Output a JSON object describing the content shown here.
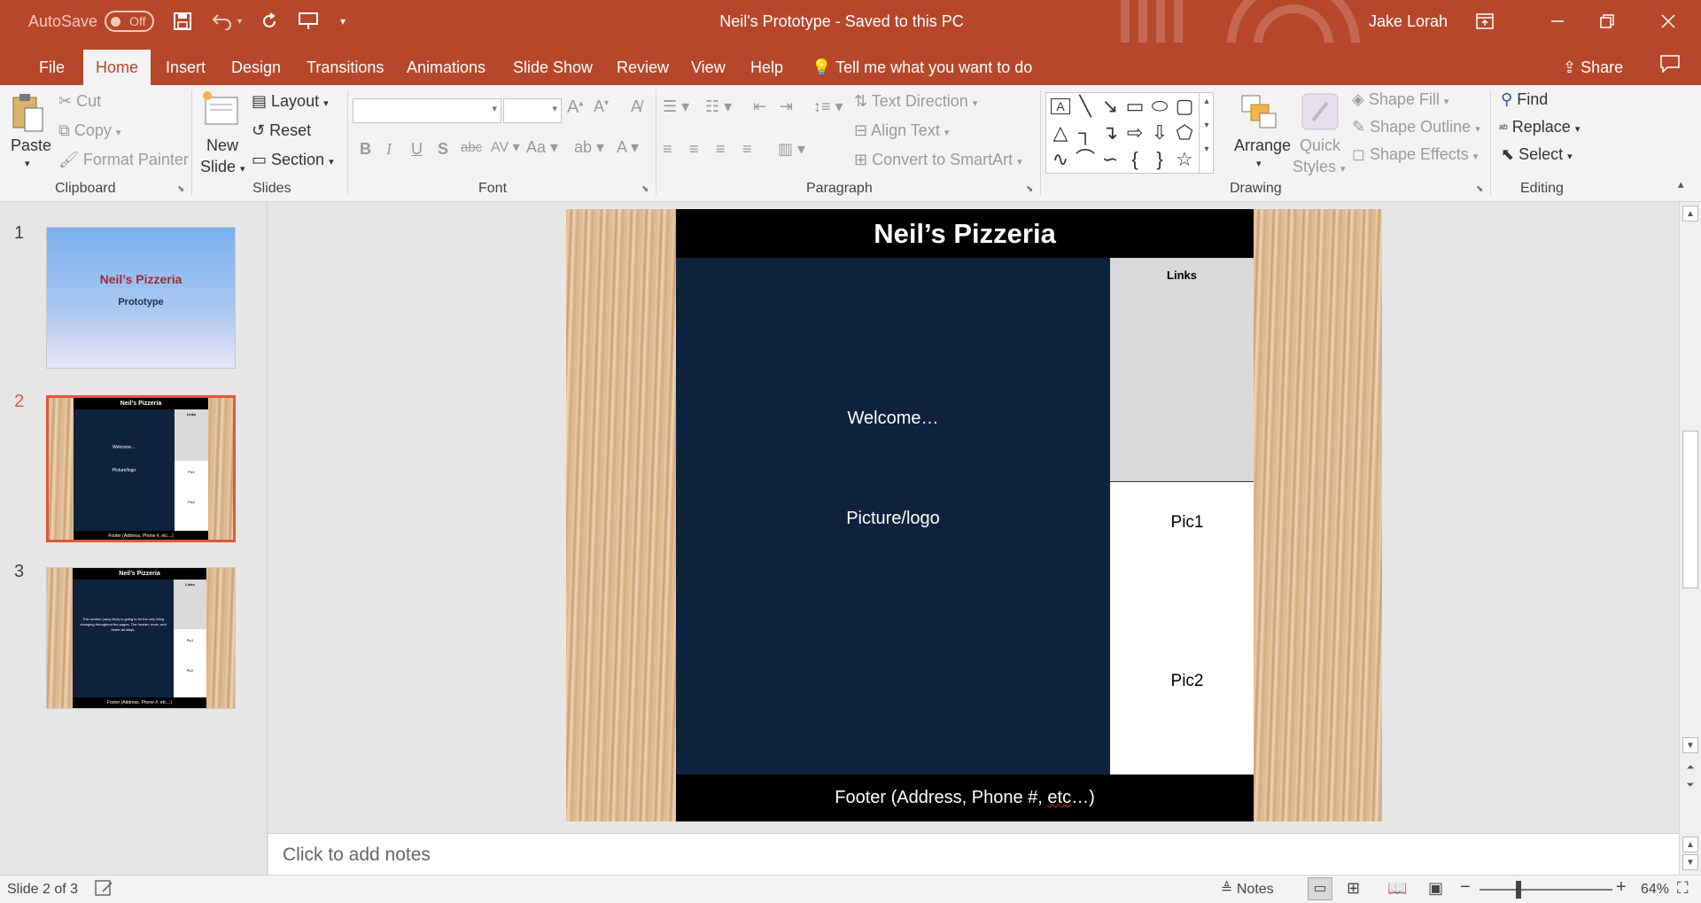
{
  "titlebar": {
    "autosave_label": "AutoSave",
    "autosave_state": "Off",
    "doc_title": "Neil's Prototype  -  Saved to this PC",
    "user": "Jake Lorah"
  },
  "tabs": [
    "File",
    "Home",
    "Insert",
    "Design",
    "Transitions",
    "Animations",
    "Slide Show",
    "Review",
    "View",
    "Help"
  ],
  "tell_me": "Tell me what you want to do",
  "share": "Share",
  "ribbon": {
    "clipboard": {
      "paste": "Paste",
      "cut": "Cut",
      "copy": "Copy",
      "format_painter": "Format Painter",
      "label": "Clipboard"
    },
    "slides": {
      "new_slide_1": "New",
      "new_slide_2": "Slide",
      "layout": "Layout",
      "reset": "Reset",
      "section": "Section",
      "label": "Slides"
    },
    "font": {
      "label": "Font"
    },
    "paragraph": {
      "text_direction": "Text Direction",
      "align_text": "Align Text",
      "convert_smartart": "Convert to SmartArt",
      "label": "Paragraph"
    },
    "drawing": {
      "arrange": "Arrange",
      "quick_1": "Quick",
      "quick_2": "Styles",
      "shape_fill": "Shape Fill",
      "shape_outline": "Shape Outline",
      "shape_effects": "Shape Effects",
      "label": "Drawing"
    },
    "editing": {
      "find": "Find",
      "replace": "Replace",
      "select": "Select",
      "label": "Editing"
    }
  },
  "thumbnails": [
    {
      "num": "1",
      "title": "Neil’s Pizzeria",
      "subtitle": "Prototype"
    },
    {
      "num": "2",
      "title": "Neil’s Pizzeria",
      "links": "Links",
      "welcome": "Welcome…",
      "picture": "Picture/logo",
      "pic1": "Pic1",
      "pic2": "Pic2",
      "footer": "Footer (Address, Phone #, etc…)"
    },
    {
      "num": "3",
      "title": "Neil’s Pizzeria",
      "links": "Links",
      "body": "This section (navy blue) is going to be the only thing changing throughout the pages. The header, ends, and footer all stays.",
      "pic1": "Pic1",
      "pic2": "Pic2",
      "footer": "Footer (Address, Phone #, etc…)"
    }
  ],
  "slide": {
    "title": "Neil’s Pizzeria",
    "links": "Links",
    "welcome": "Welcome…",
    "picture": "Picture/logo",
    "pic1": "Pic1",
    "pic2": "Pic2",
    "footer_a": "Footer (Address, Phone #, ",
    "footer_b": "etc",
    "footer_c": "…)"
  },
  "notes_placeholder": "Click to add notes",
  "status": {
    "slide_info": "Slide 2 of 3",
    "notes": "Notes",
    "zoom": "64%"
  },
  "colors": {
    "accent": "#b7472a",
    "navy": "#0f223d",
    "selected_thumb": "#e0583a"
  }
}
